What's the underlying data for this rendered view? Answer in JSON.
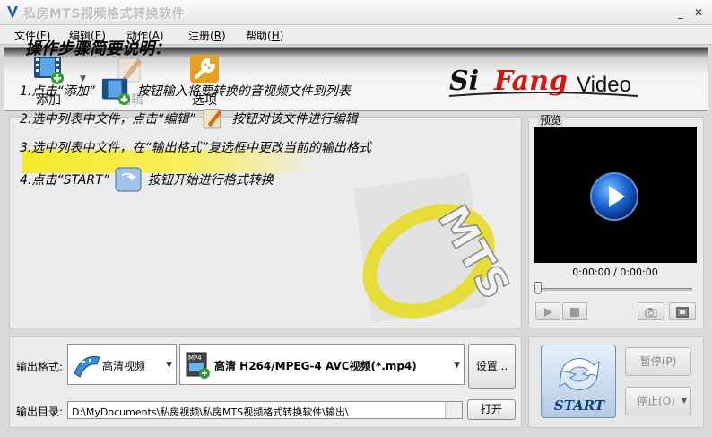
{
  "window": {
    "title": "私房MTS视频格式转换软件"
  },
  "menu": [
    {
      "label": "文件",
      "key": "(F)",
      "underline": "F"
    },
    {
      "label": "编辑",
      "key": "(E)",
      "underline": "E"
    },
    {
      "label": "动作",
      "key": "(A)",
      "underline": "A"
    },
    {
      "label": "注册",
      "key": "(R)",
      "underline": "R"
    },
    {
      "label": "帮助",
      "key": "(H)",
      "underline": "H"
    }
  ],
  "toolbar": {
    "add_label": "添加",
    "edit_label": "编辑",
    "options_label": "选项",
    "logo_si": "Si",
    "logo_fang": "Fang",
    "logo_video": "Video"
  },
  "guide": {
    "title": "操作步骤简要说明：",
    "step1_pre": "1.点击“添加”",
    "step1_post": "按钮输入将要转换的音视频文件到列表",
    "step2_pre": "2.选中列表中文件，点击“编辑”",
    "step2_post": "按钮对该文件进行编辑",
    "step3": "3.选中列表中文件，在“输出格式”复选框中更改当前的输出格式",
    "step4_pre": "4.点击“START”",
    "step4_post": "按钮开始进行格式转换",
    "watermark": "MTS"
  },
  "preview": {
    "label": "预览",
    "time": "0:00:00 / 0:00:00",
    "seek_position": 0
  },
  "output": {
    "format_label": "输出格式:",
    "category_value": "高清视频",
    "format_value": "高清 H264/MPEG-4 AVC视频(*.mp4)",
    "format_badge": "MP4",
    "settings_label": "设置...",
    "dir_label": "输出目录:",
    "dir_value": "D:\\MyDocuments\\私房视频\\私房MTS视频格式转换软件\\输出\\",
    "open_label": "打开"
  },
  "controls": {
    "start_label": "START",
    "pause_label": "暂停",
    "pause_key": "(P)",
    "stop_label": "停止",
    "stop_key": "(O)"
  },
  "colors": {
    "banner_yellow": "#f6e92a",
    "logo_red": "#d41414",
    "start_blue": "#0f3f83"
  }
}
